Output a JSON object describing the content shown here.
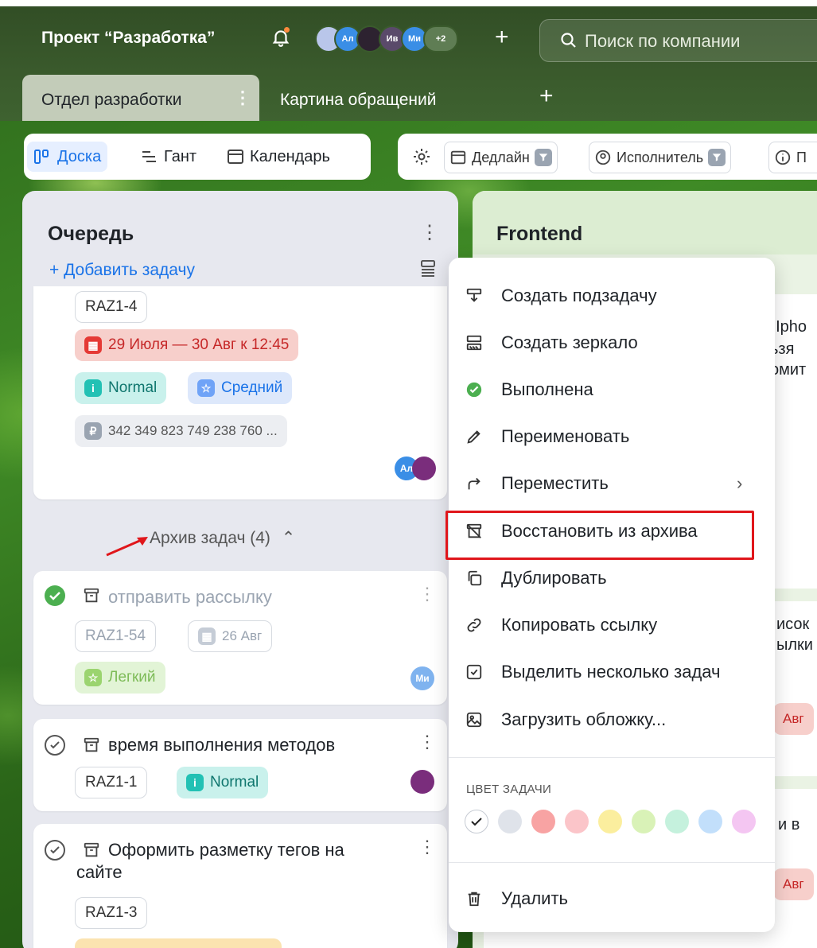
{
  "header": {
    "project_title": "Проект “Разработка”",
    "avatars": [
      {
        "label": "",
        "color": "#b9c6ea"
      },
      {
        "label": "Ал",
        "color": "#3a8ee6"
      },
      {
        "label": "",
        "color": "#2d2230"
      },
      {
        "label": "Ив",
        "color": "#5a4a6a"
      },
      {
        "label": "Ми",
        "color": "#3a8ee6"
      },
      {
        "label": "+2",
        "color": "#5f7d54"
      }
    ],
    "add_label": "+",
    "search_placeholder": "Поиск по компании"
  },
  "tabs": {
    "active": "Отдел разработки",
    "active_menu": "⋮",
    "second": "Картина обращений",
    "add": "+"
  },
  "views": {
    "board": "Доска",
    "gantt": "Гант",
    "calendar": "Календарь"
  },
  "filters": {
    "deadline": "Дедлайн",
    "assignee": "Исполнитель",
    "priority_cut": "П"
  },
  "queue_column": {
    "title": "Очередь",
    "add_task": "+ Добавить задачу",
    "card": {
      "id": "RAZ1-4",
      "date": "29 Июля — 30 Авг к 12:45",
      "priority": "Normal",
      "difficulty": "Средний",
      "money": "342 349 823 749 238 760 ...",
      "avatar": "Ал"
    },
    "archive_toggle": "Архив задач (4)",
    "archived": [
      {
        "title": "отправить рассылку",
        "id": "RAZ1-54",
        "date": "26 Авг",
        "difficulty": "Легкий",
        "avatar": "Ми"
      },
      {
        "title": "время выполнения методов",
        "id": "RAZ1-1",
        "priority": "Normal"
      },
      {
        "title_line1": "Оформить разметку тегов на",
        "title_line2": "сайте",
        "id": "RAZ1-3"
      }
    ]
  },
  "frontend_column": {
    "title": "Frontend",
    "ghost1": [
      ", Ipho",
      "ьзя",
      "омит"
    ],
    "ghost2": [
      "исок",
      "ылки"
    ],
    "badge1": "Авг",
    "ghost3": "и в",
    "badge2": "Авг"
  },
  "context_menu": {
    "items": [
      {
        "label": "Создать подзадачу",
        "icon": "subtask-icon"
      },
      {
        "label": "Создать зеркало",
        "icon": "mirror-icon"
      },
      {
        "label": "Выполнена",
        "icon": "check-circle-icon"
      },
      {
        "label": "Переименовать",
        "icon": "pencil-icon"
      },
      {
        "label": "Переместить",
        "icon": "move-arrow-icon",
        "has_submenu": true
      },
      {
        "label": "Восстановить из архива",
        "icon": "unarchive-icon",
        "highlighted": true
      },
      {
        "label": "Дублировать",
        "icon": "duplicate-icon"
      },
      {
        "label": "Копировать ссылку",
        "icon": "link-icon"
      },
      {
        "label": "Выделить несколько задач",
        "icon": "checkbox-icon"
      },
      {
        "label": "Загрузить обложку...",
        "icon": "image-icon"
      }
    ],
    "color_section_title": "ЦВЕТ ЗАДАЧИ",
    "colors": [
      "#ffffff",
      "#dfe3ea",
      "#f8a3a3",
      "#fbc5c9",
      "#fbee9e",
      "#d9f2b7",
      "#c5f1dd",
      "#c2dffb",
      "#f4c6f2"
    ],
    "delete_label": "Удалить",
    "chevron": "›"
  },
  "colors": {
    "accent_blue": "#1a73e8",
    "highlight_red": "#e0161b",
    "date_red": "#f7cfcb",
    "normal_teal": "#c9f1ec",
    "medium_blue": "#dde8fb",
    "easy_green": "#e2f4d6"
  }
}
